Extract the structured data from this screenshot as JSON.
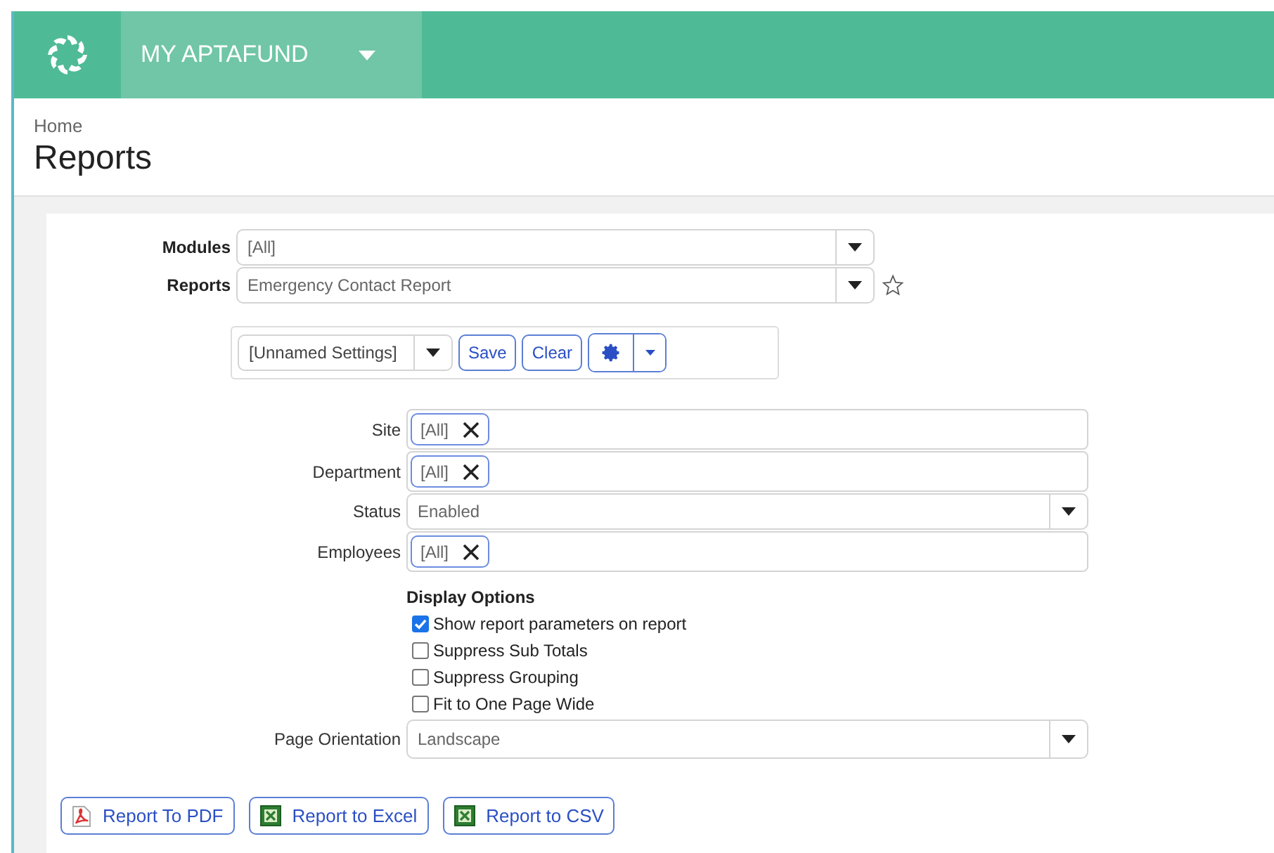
{
  "app_bar": {
    "title": "MY APTAFUND"
  },
  "breadcrumb": "Home",
  "page_title": "Reports",
  "selectors": [
    {
      "label": "Modules",
      "value": "[All]",
      "favorite": false
    },
    {
      "label": "Reports",
      "value": "Emergency Contact Report",
      "favorite": true
    }
  ],
  "settings_bar": {
    "value": "[Unnamed Settings]",
    "buttons": [
      "Save",
      "Clear"
    ]
  },
  "filters": [
    {
      "kind": "tags",
      "label": "Site",
      "tags": [
        "[All]"
      ]
    },
    {
      "kind": "tags",
      "label": "Department",
      "tags": [
        "[All]"
      ]
    },
    {
      "kind": "select",
      "label": "Status",
      "value": "Enabled"
    },
    {
      "kind": "tags",
      "label": "Employees",
      "tags": [
        "[All]"
      ]
    }
  ],
  "display_options": {
    "title": "Display Options",
    "options": [
      {
        "label": "Show report parameters on report",
        "checked": true
      },
      {
        "label": "Suppress Sub Totals",
        "checked": false
      },
      {
        "label": "Suppress Grouping",
        "checked": false
      },
      {
        "label": "Fit to One Page Wide",
        "checked": false
      }
    ]
  },
  "page_orientation": {
    "label": "Page Orientation",
    "value": "Landscape"
  },
  "export_buttons": [
    {
      "kind": "pdf",
      "label": "Report To PDF"
    },
    {
      "kind": "excel",
      "label": "Report to Excel"
    },
    {
      "kind": "excel",
      "label": "Report to CSV"
    }
  ]
}
